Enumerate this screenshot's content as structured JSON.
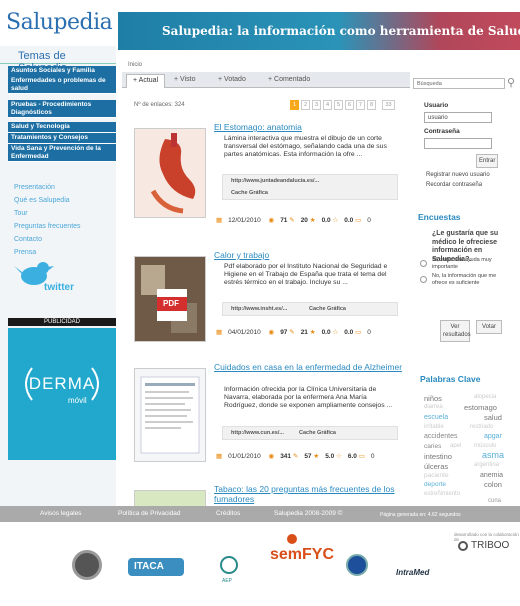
{
  "header": {
    "site_name": "Salupedia",
    "banner_text": "Salupedia: la información como herramienta de Salud."
  },
  "sidebar": {
    "topics_title": "Temas de Salupedia",
    "topics": [
      "Asuntos Sociales y Familia",
      "Enfermedades o problemas de salud",
      "Pruebas - Procedimientos Diagnósticos",
      "Salud y Tecnología",
      "Tratamientos y Consejos",
      "Vida Sana y Prevención de la Enfermedad"
    ],
    "links": [
      "Presentación",
      "Qué es Salupedia",
      "Tour",
      "Preguntas frecuentes",
      "Contacto",
      "Prensa"
    ],
    "twitter": "twitter",
    "pub_label": "PUBLICIDAD",
    "ad_brand": "DERMA",
    "ad_sub": "móvil"
  },
  "main": {
    "breadcrumb": "Inicio",
    "tabs": [
      "+ Actual",
      "+ Visto",
      "+ Votado",
      "+ Comentado"
    ],
    "count_label": "Nº de enlaces: 324",
    "pages": [
      "1",
      "2",
      "3",
      "4",
      "5",
      "6",
      "7",
      "8",
      "33"
    ],
    "articles": [
      {
        "title": "El Estomago: anatomia",
        "desc": "Lámina interactiva que muestra el dibujo de un corte transversal del estómago, señalando cada una de sus partes anatómicas. Esta información la ofre ...",
        "url": "http://www.juntadeandalucia.es/...",
        "cache": "Cache Gráfica",
        "date": "12/01/2010",
        "views": "71",
        "comments": "20",
        "rating1": "0.0",
        "rating2": "0.0",
        "notes": "0"
      },
      {
        "title": "Calor y trabajo",
        "desc": "Pdf elaborado por el Instituto Nacional de Seguridad e Higiene en el Trabajo de España que trata el tema del estrés térmico en el trabajo. Incluye su ...",
        "url": "http://www.insht.es/...",
        "cache": "Cache Gráfica",
        "date": "04/01/2010",
        "views": "97",
        "comments": "21",
        "rating1": "0.0",
        "rating2": "0.0",
        "notes": "0",
        "thumb_label": "PDF"
      },
      {
        "title": "Cuidados en casa en la enfermedad de Alzheimer",
        "desc": "Información ofrecida por la Clínica Universitaria de Navarra, elaborada por la enfermera Ana María Rodríguez, donde se exponen ampliamente consejos ...",
        "url": "http://www.cun.es/...",
        "cache": "Cache Gráfica",
        "date": "01/01/2010",
        "views": "341",
        "comments": "57",
        "rating1": "5.0",
        "rating2": "6.0",
        "notes": "0"
      },
      {
        "title": "Tabaco: las 20 preguntas más frecuentes de los fumadores"
      }
    ]
  },
  "right": {
    "search_placeholder": "Búsqueda",
    "user_label": "Usuario",
    "user_value": "usuario",
    "pass_label": "Contraseña",
    "enter_button": "Entrar",
    "register": "Registrar nuevo usuario",
    "recover": "Recordar contraseña",
    "poll_title": "Encuestas",
    "poll_question": "¿Le gustaría que su médico le ofreciese información en Salupedia?.",
    "poll_options": [
      "Sí, sería una ayuda muy importante",
      "No, la información que me ofrece es suficiente"
    ],
    "results_button": "Ver resultados",
    "vote_button": "Votar",
    "keywords_title": "Palabras Clave",
    "keywords": [
      "niños",
      "alopecia",
      "diarrea",
      "estomago",
      "escuela",
      "salud",
      "irritable",
      "restriado",
      "accidentes",
      "apgar",
      "caries",
      "apel",
      "músculo",
      "intestino",
      "asma",
      "úlceras",
      "argentina",
      "paciente",
      "anemia",
      "deporte",
      "colon",
      "estreñimiento",
      "cuna"
    ]
  },
  "footer": {
    "links": [
      "Avisos legales",
      "Política de Privacidad",
      "Créditos",
      "Salupedia 2008-2009 ©",
      "Página generada en: 4.62 segundos"
    ],
    "triboo_small": "desarrollado con la colaboración de",
    "triboo": "TRIBOO",
    "itaca": "ITACA",
    "aep": "AEP",
    "semfyc": "semFYC",
    "intramed": "IntraMed"
  }
}
